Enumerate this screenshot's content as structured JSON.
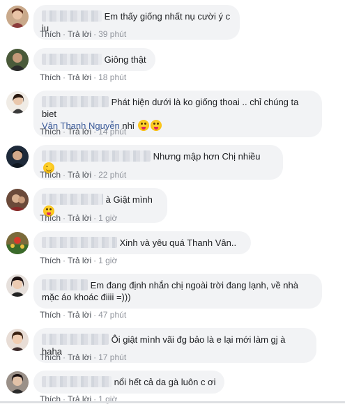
{
  "actions": {
    "like": "Thích",
    "reply": "Trả lời",
    "separator": "·"
  },
  "colors": {
    "bubble": "#f2f3f5",
    "link": "#385898",
    "meta": "#90949c"
  },
  "comments": [
    {
      "text": "Em thấy giống nhất nụ cười ý c iu",
      "time": "39 phút"
    },
    {
      "text": "Giông thật",
      "time": "18 phút"
    },
    {
      "text": "Phát hiện dưới là ko giống thoai .. chỉ chúng ta biet",
      "mention": "Vân Thanh Nguyễn",
      "text_after": "nhỉ",
      "time": "14 phút"
    },
    {
      "text": "Nhưng mập hơn Chị nhiều",
      "time": "22 phút"
    },
    {
      "text": "à Giật mình",
      "time": "1 giờ"
    },
    {
      "text": "Xinh và yêu quá Thanh Vân..",
      "time": "1 giờ"
    },
    {
      "text": "Em đang định nhắn chị ngoài trời đang lạnh, về nhà mặc áo khoác điiii =)))",
      "time": "47 phút"
    },
    {
      "text": "Ôi giật mình vãi đg bảo là e lại mới làm gj à haha",
      "time": "17 phút"
    },
    {
      "text": "nổi hết cả da gà luôn c ơi",
      "time": "1 giờ"
    }
  ]
}
